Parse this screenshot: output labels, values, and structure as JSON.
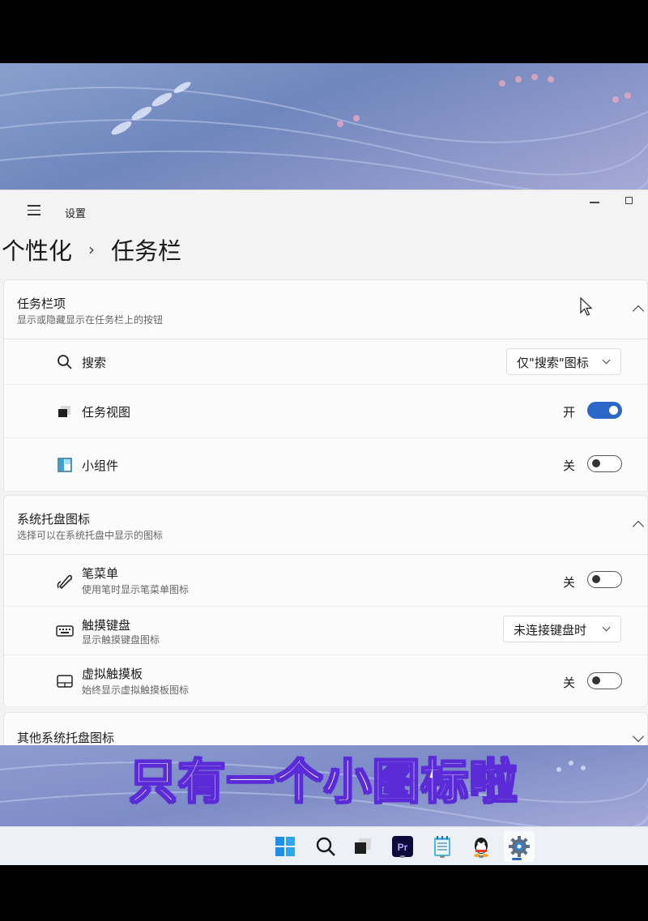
{
  "window": {
    "app_title": "设置",
    "breadcrumb": {
      "parent": "个性化",
      "separator": "›",
      "current": "任务栏"
    }
  },
  "sections": {
    "taskbar_items": {
      "title": "任务栏项",
      "subtitle": "显示或隐藏显示在任务栏上的按钮",
      "rows": {
        "search": {
          "label": "搜索",
          "dropdown_value": "仅\"搜索\"图标"
        },
        "task_view": {
          "label": "任务视图",
          "state": "开",
          "toggle_on": true
        },
        "widgets": {
          "label": "小组件",
          "state": "关",
          "toggle_on": false
        }
      }
    },
    "tray_icons": {
      "title": "系统托盘图标",
      "subtitle": "选择可以在系统托盘中显示的图标",
      "rows": {
        "pen_menu": {
          "label": "笔菜单",
          "sub": "使用笔时显示笔菜单图标",
          "state": "关",
          "toggle_on": false
        },
        "touch_keyboard": {
          "label": "触摸键盘",
          "sub": "显示触摸键盘图标",
          "dropdown_value": "未连接键盘时"
        },
        "virtual_touchpad": {
          "label": "虚拟触摸板",
          "sub": "始终显示虚拟触摸板图标",
          "state": "关",
          "toggle_on": false
        }
      }
    },
    "other_tray": {
      "title": "其他系统托盘图标"
    }
  },
  "caption": "只有一个小图标啦",
  "taskbar": {
    "icons": [
      "windows-start-icon",
      "search-icon",
      "task-view-icon",
      "premiere-pro-icon",
      "notepad-icon",
      "qq-icon",
      "settings-icon"
    ],
    "premiere_label": "Pr",
    "active_app": "settings-icon"
  },
  "colors": {
    "accent": "#2b67c9",
    "caption_stroke": "#5b2bd8",
    "window_bg": "#f3f3f3",
    "card_bg": "#fbfbfb"
  }
}
